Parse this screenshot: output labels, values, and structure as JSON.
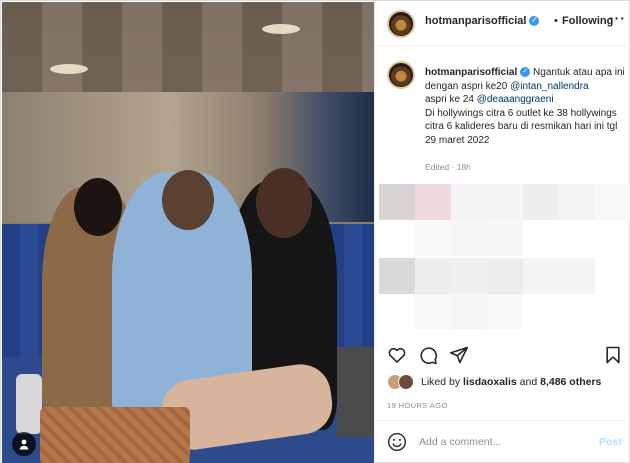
{
  "post": {
    "username": "hotmanparisofficial",
    "follow_state": "Following",
    "separator": "•",
    "more_glyph": "···",
    "verified_glyph": "✓",
    "caption_segments": {
      "t1": "Ngantuk atau apa ini dengan aspri ke20",
      "m1": "@intan_nallendra",
      "t2": "aspri ke 24",
      "m2": "@deaaanggraeni",
      "t3": "Di hollywings citra 6 outlet ke 38 hollywings citra 6 kalideres baru di resmikan hari ini tgl 29 maret 2022"
    },
    "edited": "Edited",
    "edited_sep": "·",
    "edited_time": "18h",
    "liked_prefix": "Liked by",
    "liked_user": "lisdaoxalis",
    "liked_and": "and",
    "liked_others": "8,486 others",
    "timestamp": "19 HOURS AGO",
    "comment_placeholder": "Add a comment...",
    "post_label": "Post"
  },
  "icons": {
    "like": "heart-icon",
    "comment": "comment-icon",
    "share": "share-icon",
    "save": "bookmark-icon",
    "emoji": "emoji-icon",
    "tag": "user-tag-icon"
  },
  "colors": {
    "link": "#00376b",
    "verified": "#3897f0",
    "post_disabled": "#b2dffc",
    "muted": "#8e8e8e"
  }
}
